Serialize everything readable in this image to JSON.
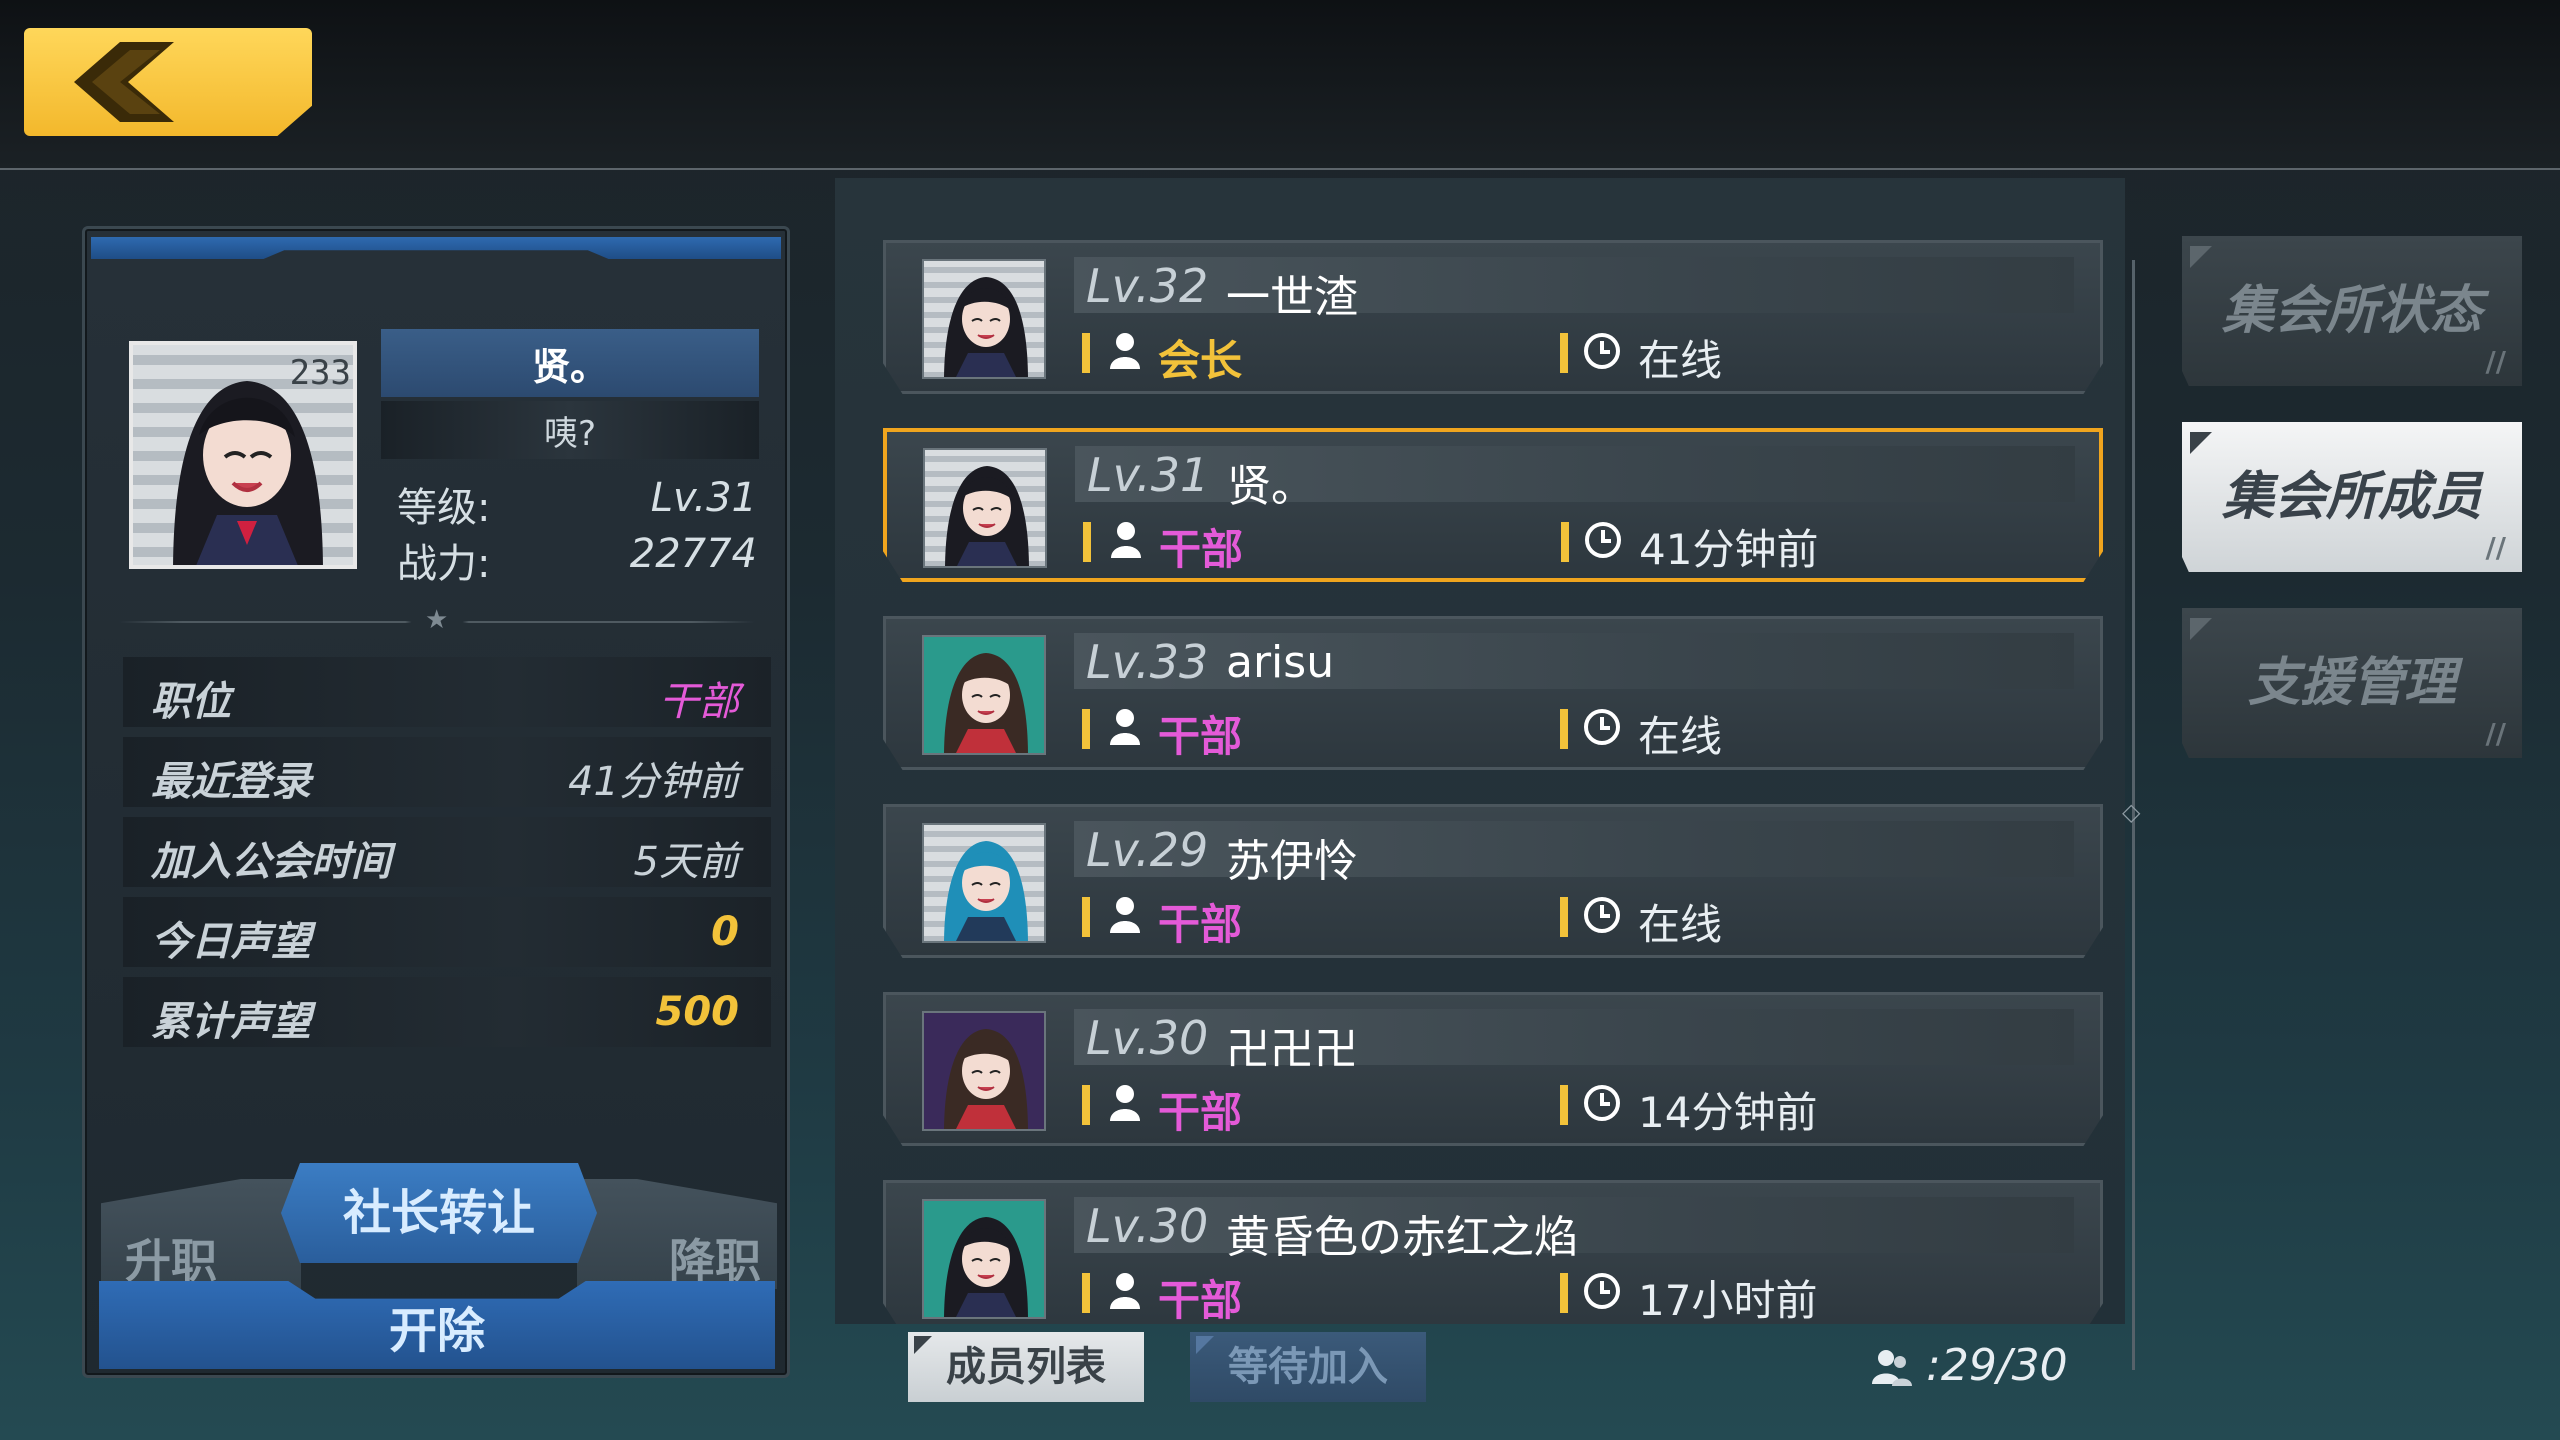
{
  "profile": {
    "name": "贤。",
    "status": "咦?",
    "level_label": "等级:",
    "level_value": "Lv.31",
    "power_label": "战力:",
    "power_value": "22774",
    "info": [
      {
        "label": "职位",
        "value": "干部",
        "color": "#e45ad8"
      },
      {
        "label": "最近登录",
        "value": "41分钟前",
        "color": "#c9d2d8"
      },
      {
        "label": "加入公会时间",
        "value": "5天前",
        "color": "#c9d2d8"
      },
      {
        "label": "今日声望",
        "value": "0",
        "color": "#f2c23a"
      },
      {
        "label": "累计声望",
        "value": "500",
        "color": "#f2c23a"
      }
    ],
    "buttons": {
      "promote": "升职",
      "transfer": "社长转让",
      "demote": "降职",
      "expel": "开除"
    }
  },
  "members": [
    {
      "level": "Lv.32",
      "name": "一世渣",
      "role": "会长",
      "role_color": "#f2c23a",
      "last_seen": "在线",
      "selected": false
    },
    {
      "level": "Lv.31",
      "name": "贤。",
      "role": "干部",
      "role_color": "#e45ad8",
      "last_seen": "41分钟前",
      "selected": true
    },
    {
      "level": "Lv.33",
      "name": "arisu",
      "role": "干部",
      "role_color": "#e45ad8",
      "last_seen": "在线",
      "selected": false
    },
    {
      "level": "Lv.29",
      "name": "苏伊怜",
      "role": "干部",
      "role_color": "#e45ad8",
      "last_seen": "在线",
      "selected": false
    },
    {
      "level": "Lv.30",
      "name": "卍卍卍",
      "role": "干部",
      "role_color": "#e45ad8",
      "last_seen": "14分钟前",
      "selected": false
    },
    {
      "level": "Lv.30",
      "name": "黄昏色の赤红之焰",
      "role": "干部",
      "role_color": "#e45ad8",
      "last_seen": "17小时前",
      "selected": false
    }
  ],
  "avatar_badge": "233",
  "tabs": {
    "members": "成员列表",
    "pending": "等待加入"
  },
  "member_count": ":29/30",
  "side_tabs": [
    {
      "label": "集会所状态",
      "active": false
    },
    {
      "label": "集会所成员",
      "active": true
    },
    {
      "label": "支援管理",
      "active": false
    }
  ],
  "icons": {
    "back": "back-arrow-icon",
    "role": "person-icon",
    "time": "clock-icon",
    "count": "members-icon"
  }
}
